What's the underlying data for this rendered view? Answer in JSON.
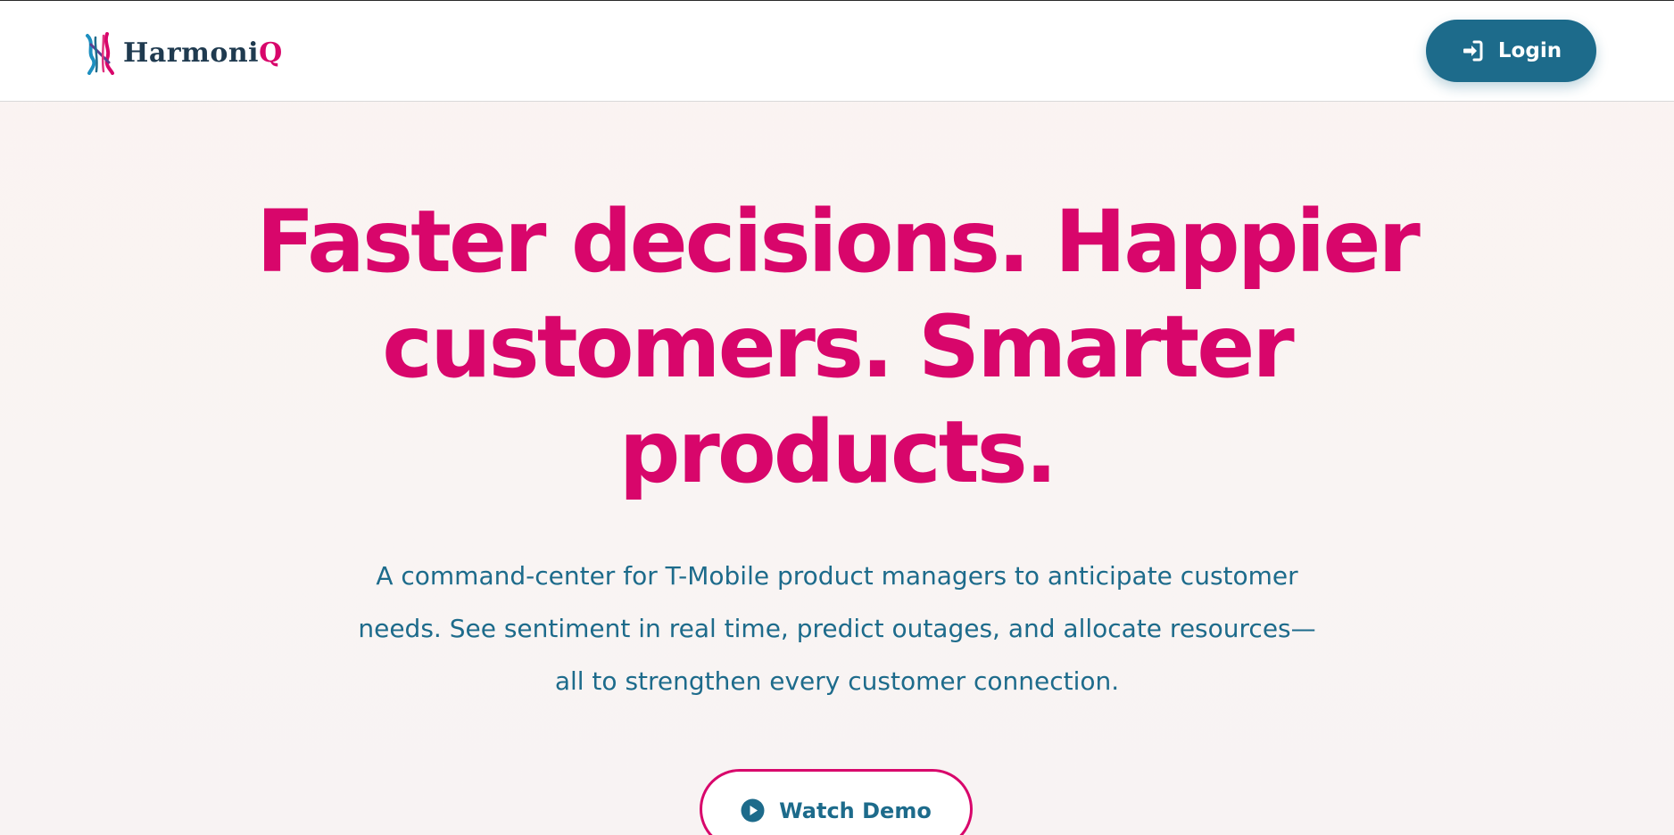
{
  "header": {
    "brand": {
      "name_part1": "Harmoni",
      "name_part2": "Q",
      "logo_icon": "harmoniq-logo-icon"
    },
    "login": {
      "label": "Login",
      "icon": "sign-in-icon"
    }
  },
  "hero": {
    "headline": "Faster decisions. Happier customers. Smarter products.",
    "subtext": "A command-center for T-Mobile product managers to anticipate customer needs. See sentiment in real time, predict outages, and allocate resources—all to strengthen every customer connection.",
    "cta": {
      "label": "Watch Demo",
      "icon": "play-circle-icon"
    }
  },
  "colors": {
    "brand_magenta": "#d8066b",
    "brand_teal": "#1d6b8b",
    "brand_navy": "#1f3a4f",
    "page_background": "#faf4f2"
  }
}
